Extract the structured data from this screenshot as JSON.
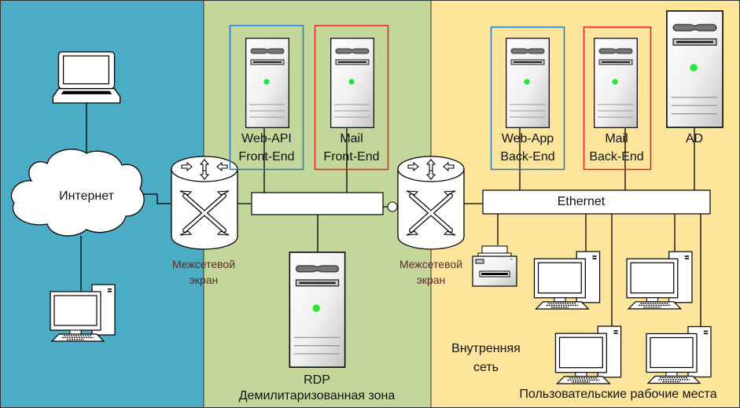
{
  "colors": {
    "internet_zone": "#4bacc6",
    "dmz_zone": "#c4d79b",
    "internal_zone": "#fee59c",
    "front_back_blue": "#1f78c8",
    "front_back_red": "#ee1c1c",
    "server_led": "#22e83a",
    "firewall_label": "#5b2b28"
  },
  "internet_zone": {
    "cloud_label": "Интернет",
    "firewall_label_line1": "Межсетевой",
    "firewall_label_line2": "экран"
  },
  "dmz": {
    "web_api_line1": "Web-API",
    "web_api_line2": "Front-End",
    "mail_line1": "Mail",
    "mail_line2": "Front-End",
    "rdp": "RDP",
    "zone_label": "Демилитаризованная зона",
    "firewall_label_line1": "Межсетевой",
    "firewall_label_line2": "экран"
  },
  "internal": {
    "web_app_line1": "Web-App",
    "web_app_line2": "Back-End",
    "mail_line1": "Mail",
    "mail_line2": "Back-End",
    "ad": "AD",
    "ethernet": "Ethernet",
    "zone_label_line1": "Внутренняя",
    "zone_label_line2": "сеть",
    "workstations_label": "Пользовательские рабочие места"
  },
  "icons": [
    "laptop-icon",
    "cloud-icon",
    "desktop-icon",
    "firewall-icon",
    "server-icon",
    "printer-icon"
  ]
}
